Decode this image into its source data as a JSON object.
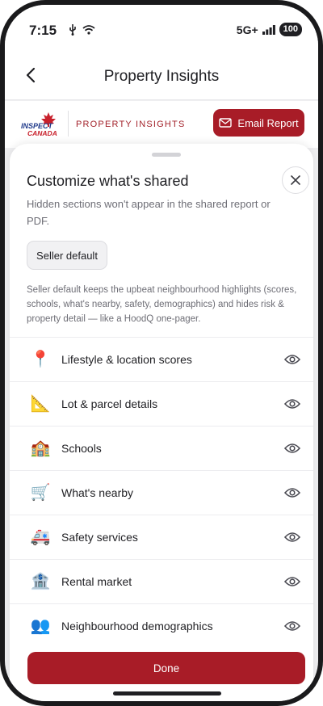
{
  "status_bar": {
    "time": "7:15",
    "network": "5G+",
    "battery": "100"
  },
  "header": {
    "title": "Property Insights"
  },
  "brand": {
    "logo_text": "INSPECT CANADA",
    "section_label": "PROPERTY INSIGHTS",
    "email_button": "Email Report",
    "accent_color": "#a81c27"
  },
  "sheet": {
    "title": "Customize what's shared",
    "subtitle": "Hidden sections won't appear in the shared report or PDF.",
    "default_button": "Seller default",
    "note": "Seller default keeps the upbeat neighbourhood highlights (scores, schools, what's nearby, safety, demographics) and hides risk & property detail — like a HoodQ one-pager.",
    "sections": [
      {
        "icon": "📍",
        "icon_name": "pin-icon",
        "label": "Lifestyle & location scores"
      },
      {
        "icon": "📐",
        "icon_name": "triangle-ruler-icon",
        "label": "Lot & parcel details"
      },
      {
        "icon": "🏫",
        "icon_name": "school-icon",
        "label": "Schools"
      },
      {
        "icon": "🛒",
        "icon_name": "cart-icon",
        "label": "What's nearby"
      },
      {
        "icon": "🚑",
        "icon_name": "ambulance-icon",
        "label": "Safety services"
      },
      {
        "icon": "🏦",
        "icon_name": "bank-icon",
        "label": "Rental market"
      },
      {
        "icon": "👥",
        "icon_name": "people-icon",
        "label": "Neighbourhood demographics"
      }
    ],
    "done_button": "Done"
  }
}
